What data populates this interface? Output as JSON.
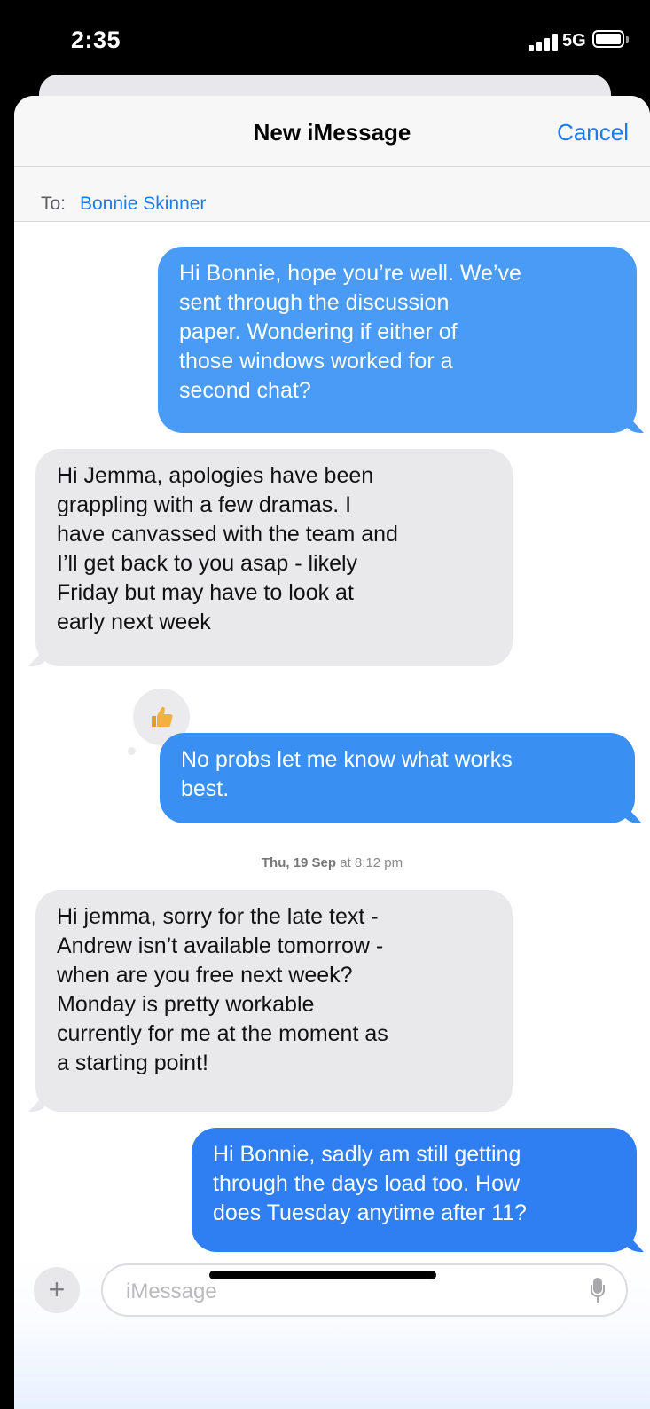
{
  "status_bar": {
    "time": "2:35",
    "network": "5G"
  },
  "header": {
    "title": "New iMessage",
    "cancel_label": "Cancel"
  },
  "to_row": {
    "label": "To:",
    "recipient": "Bonnie Skinner"
  },
  "messages": [
    {
      "direction": "sent",
      "lines": [
        "Hi Bonnie, hope you’re well. We’ve",
        "sent through the discussion",
        "paper. Wondering if either of",
        "those windows worked for a",
        "second chat?"
      ]
    },
    {
      "direction": "received",
      "lines": [
        "Hi Jemma, apologies have been",
        "grappling with a few dramas. I",
        "have canvassed with the team and",
        "I’ll get back to you asap - likely",
        "Friday but may have to look at",
        "early next week"
      ]
    },
    {
      "direction": "sent",
      "lines": [
        "No probs let me know what works",
        "best."
      ],
      "tapback": "thumbs-up"
    },
    {
      "direction": "received",
      "lines": [
        "Hi jemma, sorry for the late text -",
        "Andrew isn’t available tomorrow -",
        "when are you free next week?",
        "Monday is pretty workable",
        "currently for me at the moment as",
        "a starting point!"
      ]
    },
    {
      "direction": "sent",
      "lines": [
        "Hi Bonnie, sadly am still getting",
        "through the days load too. How",
        "does Tuesday anytime after 11?"
      ]
    }
  ],
  "timestamp": {
    "day": "Thu, 19 Sep",
    "rest": " at 8:12 pm"
  },
  "input": {
    "placeholder": "iMessage",
    "plus_label": "+"
  },
  "icons": {
    "tapback": "thumbs-up-icon",
    "mic": "microphone-icon",
    "plus": "plus-icon"
  },
  "colors": {
    "accent": "#1a7cf5",
    "sent_bubble": "#3d94f6",
    "received_bubble": "#e9e9eb"
  }
}
